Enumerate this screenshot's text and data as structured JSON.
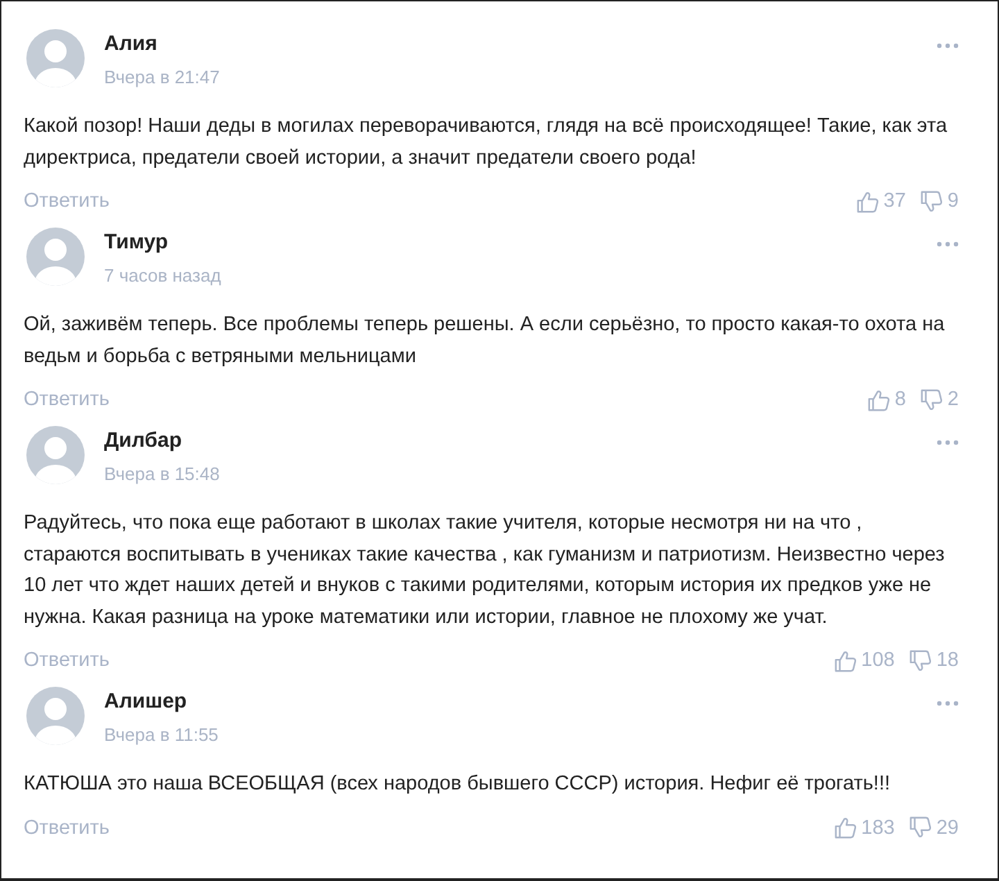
{
  "comments": [
    {
      "author": "Алия",
      "time": "Вчера в 21:47",
      "text": "Какой позор! Наши деды в могилах переворачиваются, глядя на всё происходящее! Такие, как эта директриса, предатели своей истории, а значит предатели своего рода!",
      "reply": "Ответить",
      "likes": "37",
      "dislikes": "9"
    },
    {
      "author": "Тимур",
      "time": "7 часов назад",
      "text": "Ой, заживём теперь. Все проблемы теперь решены. А если серьёзно, то просто какая-то охота на ведьм и борьба с ветряными мельницами",
      "reply": "Ответить",
      "likes": "8",
      "dislikes": "2"
    },
    {
      "author": "Дилбар",
      "time": "Вчера в 15:48",
      "text": "Радуйтесь, что пока еще работают в школах такие учителя, которые несмотря ни на что , стараются воспитывать в учениках такие качества , как гуманизм и патриотизм. Неизвестно через 10 лет что ждет наших детей и внуков с такими родителями, которым история их предков уже не нужна. Какая разница на уроке математики или истории, главное не плохому же учат.",
      "reply": "Ответить",
      "likes": "108",
      "dislikes": "18"
    },
    {
      "author": "Алишер",
      "time": "Вчера в 11:55",
      "text": "КАТЮША это наша ВСЕОБЩАЯ (всех народов бывшего СССР) история. Нефиг её трогать!!!",
      "reply": "Ответить",
      "likes": "183",
      "dislikes": "29"
    }
  ]
}
